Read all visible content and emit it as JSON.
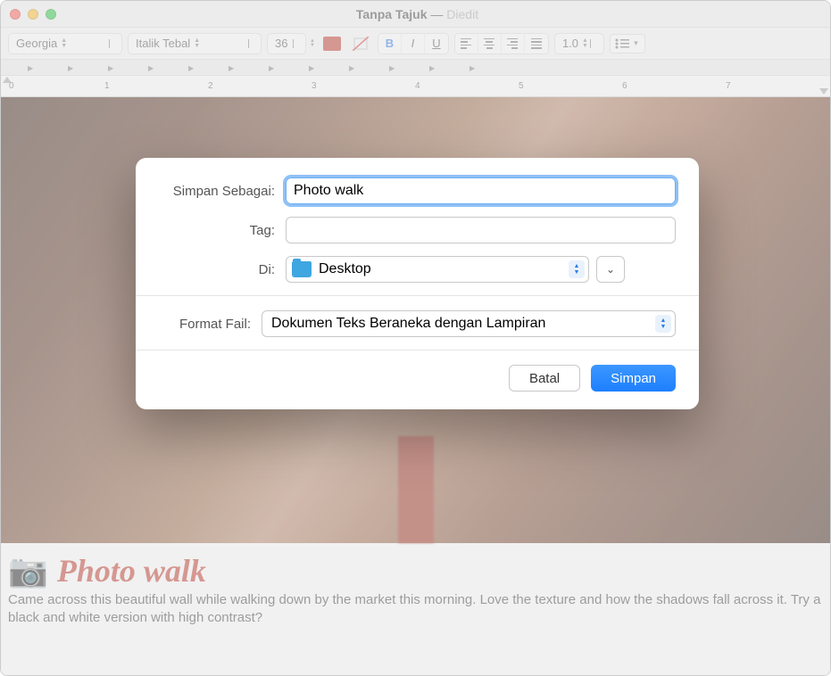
{
  "window": {
    "title_main": "Tanpa Tajuk",
    "title_sep": " — ",
    "title_state": "Diedit"
  },
  "toolbar": {
    "font_family": "Georgia",
    "font_style": "Italik Tebal",
    "font_size": "36",
    "color_swatch": "#c0392b",
    "bold": "B",
    "italic": "I",
    "underline": "U",
    "line_spacing": "1.0"
  },
  "ruler": {
    "marks": [
      "0",
      "1",
      "2",
      "3",
      "4",
      "5",
      "6",
      "7"
    ]
  },
  "document": {
    "title": "Photo walk",
    "body": "Came across this beautiful wall while walking down by the market this morning. Love the texture and how the shadows fall across it. Try a black and white version with high contrast?"
  },
  "dialog": {
    "save_as_label": "Simpan Sebagai:",
    "save_as_value": "Photo walk",
    "tag_label": "Tag:",
    "tag_value": "",
    "where_label": "Di:",
    "where_value": "Desktop",
    "format_label": "Format Fail:",
    "format_value": "Dokumen Teks Beraneka dengan Lampiran",
    "cancel": "Batal",
    "save": "Simpan"
  }
}
